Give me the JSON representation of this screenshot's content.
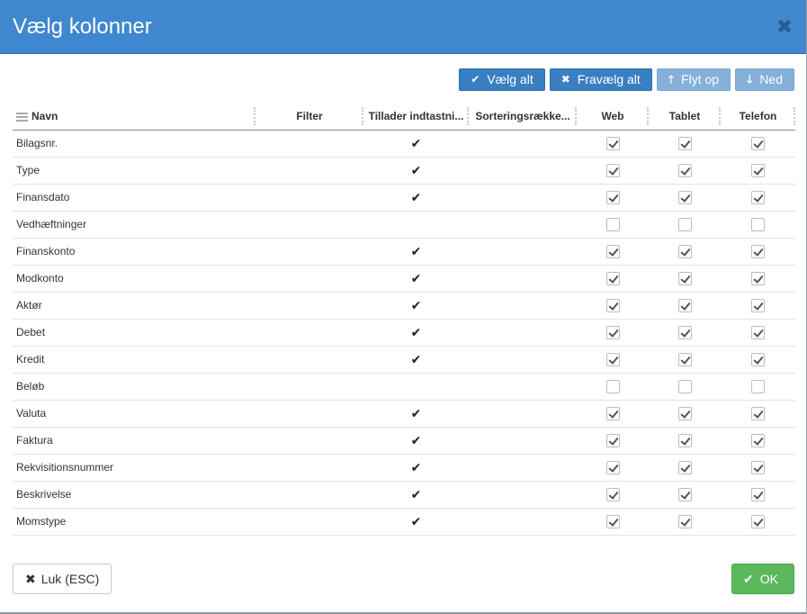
{
  "dialog": {
    "title": "Vælg kolonner",
    "close_icon": "close-icon"
  },
  "toolbar": {
    "select_all_label": "Vælg alt",
    "deselect_all_label": "Fravælg alt",
    "move_up_label": "Flyt op",
    "move_down_label": "Ned"
  },
  "table": {
    "headers": {
      "name": "Navn",
      "filter": "Filter",
      "allows_input": "Tillader indtastni...",
      "sort_order": "Sorteringsrække...",
      "web": "Web",
      "tablet": "Tablet",
      "phone": "Telefon"
    },
    "rows": [
      {
        "name": "Bilagsnr.",
        "allows_input": true,
        "web": true,
        "tablet": true,
        "phone": true
      },
      {
        "name": "Type",
        "allows_input": true,
        "web": true,
        "tablet": true,
        "phone": true
      },
      {
        "name": "Finansdato",
        "allows_input": true,
        "web": true,
        "tablet": true,
        "phone": true
      },
      {
        "name": "Vedhæftninger",
        "allows_input": false,
        "web": false,
        "tablet": false,
        "phone": false
      },
      {
        "name": "Finanskonto",
        "allows_input": true,
        "web": true,
        "tablet": true,
        "phone": true
      },
      {
        "name": "Modkonto",
        "allows_input": true,
        "web": true,
        "tablet": true,
        "phone": true
      },
      {
        "name": "Aktør",
        "allows_input": true,
        "web": true,
        "tablet": true,
        "phone": true
      },
      {
        "name": "Debet",
        "allows_input": true,
        "web": true,
        "tablet": true,
        "phone": true
      },
      {
        "name": "Kredit",
        "allows_input": true,
        "web": true,
        "tablet": true,
        "phone": true
      },
      {
        "name": "Beløb",
        "allows_input": false,
        "web": false,
        "tablet": false,
        "phone": false
      },
      {
        "name": "Valuta",
        "allows_input": true,
        "web": true,
        "tablet": true,
        "phone": true
      },
      {
        "name": "Faktura",
        "allows_input": true,
        "web": true,
        "tablet": true,
        "phone": true
      },
      {
        "name": "Rekvisitionsnummer",
        "allows_input": true,
        "web": true,
        "tablet": true,
        "phone": true
      },
      {
        "name": "Beskrivelse",
        "allows_input": true,
        "web": true,
        "tablet": true,
        "phone": true
      },
      {
        "name": "Momstype",
        "allows_input": true,
        "web": true,
        "tablet": true,
        "phone": true
      }
    ]
  },
  "footer": {
    "close_label": "Luk (ESC)",
    "ok_label": "OK"
  },
  "colors": {
    "header_blue": "#3f88cf",
    "primary_button": "#3a7fc1",
    "disabled_button": "#84b0da",
    "ok_green": "#5cb85c"
  }
}
